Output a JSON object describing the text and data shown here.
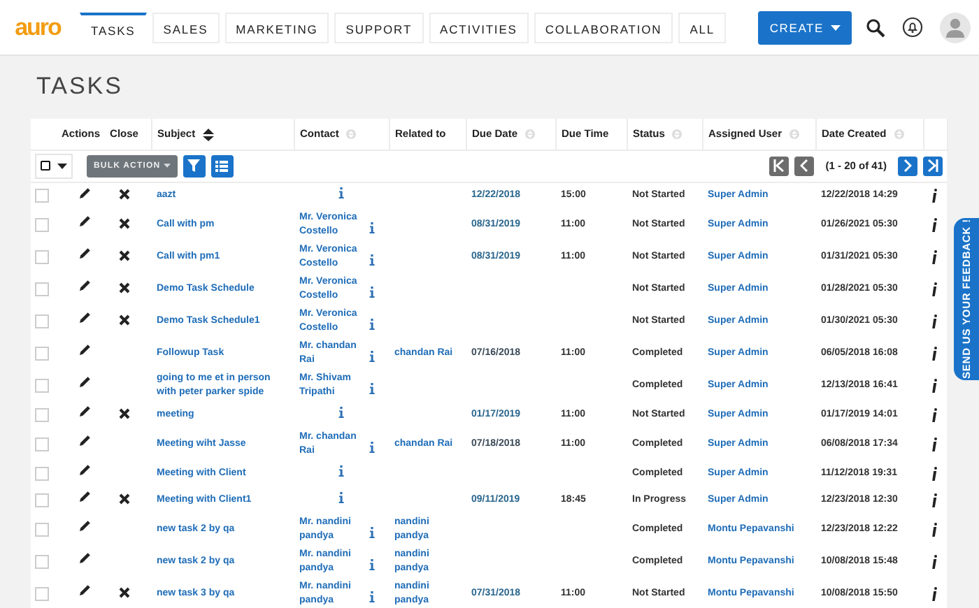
{
  "nav": {
    "logo": "auro",
    "tabs": [
      {
        "label": "TASKS",
        "selected": true
      },
      {
        "label": "SALES",
        "selected": false
      },
      {
        "label": "MARKETING",
        "selected": false
      },
      {
        "label": "SUPPORT",
        "selected": false
      },
      {
        "label": "ACTIVITIES",
        "selected": false
      },
      {
        "label": "COLLABORATION",
        "selected": false
      },
      {
        "label": "ALL",
        "selected": false
      }
    ],
    "create_button": "CREATE"
  },
  "page_title": "TASKS",
  "table": {
    "columns": [
      {
        "label": "Actions",
        "sortable": false
      },
      {
        "label": "Close",
        "sortable": false
      },
      {
        "label": "Subject",
        "sortable": true,
        "sorted": true
      },
      {
        "label": "Contact",
        "sortable": true,
        "sorted": false
      },
      {
        "label": "Related to",
        "sortable": false
      },
      {
        "label": "Due Date",
        "sortable": true,
        "sorted": false
      },
      {
        "label": "Due Time",
        "sortable": false
      },
      {
        "label": "Status",
        "sortable": true,
        "sorted": false
      },
      {
        "label": "Assigned User",
        "sortable": true,
        "sorted": false
      },
      {
        "label": "Date Created",
        "sortable": true,
        "sorted": false
      }
    ],
    "bulk_action": "BULK ACTION",
    "pagination": "(1 - 20 of 41)",
    "rows": [
      {
        "checked": false,
        "closable": true,
        "subject": "aazt",
        "contact": "",
        "related": "",
        "due_date": "12/22/2018",
        "due_time": "15:00",
        "status": "Not Started",
        "assigned": "Super Admin",
        "created": "12/22/2018 14:29"
      },
      {
        "checked": false,
        "closable": true,
        "subject": "Call with pm",
        "contact": "Mr. Veronica Costello",
        "related": "",
        "due_date": "08/31/2019",
        "due_time": "11:00",
        "status": "Not Started",
        "assigned": "Super Admin",
        "created": "01/26/2021 05:30"
      },
      {
        "checked": false,
        "closable": true,
        "subject": "Call with pm1",
        "contact": "Mr. Veronica Costello",
        "related": "",
        "due_date": "08/31/2019",
        "due_time": "11:00",
        "status": "Not Started",
        "assigned": "Super Admin",
        "created": "01/31/2021 05:30"
      },
      {
        "checked": false,
        "closable": true,
        "subject": "Demo Task Schedule",
        "contact": "Mr. Veronica Costello",
        "related": "",
        "due_date": "",
        "due_time": "",
        "status": "Not Started",
        "assigned": "Super Admin",
        "created": "01/28/2021 05:30"
      },
      {
        "checked": false,
        "closable": true,
        "subject": "Demo Task Schedule1",
        "contact": "Mr. Veronica Costello",
        "related": "",
        "due_date": "",
        "due_time": "",
        "status": "Not Started",
        "assigned": "Super Admin",
        "created": "01/30/2021 05:30"
      },
      {
        "checked": false,
        "closable": false,
        "subject": "Followup Task",
        "contact": "Mr. chandan Rai",
        "related": "chandan Rai",
        "due_date": "07/16/2018",
        "due_time": "11:00",
        "status": "Completed",
        "assigned": "Super Admin",
        "created": "06/05/2018 16:08"
      },
      {
        "checked": false,
        "closable": false,
        "subject": "going to me et in person with peter parker spide",
        "contact": "Mr. Shivam Tripathi",
        "related": "",
        "due_date": "",
        "due_time": "",
        "status": "Completed",
        "assigned": "Super Admin",
        "created": "12/13/2018 16:41"
      },
      {
        "checked": false,
        "closable": true,
        "subject": "meeting",
        "contact": "",
        "related": "",
        "due_date": "01/17/2019",
        "due_time": "11:00",
        "status": "Not Started",
        "assigned": "Super Admin",
        "created": "01/17/2019 14:01"
      },
      {
        "checked": false,
        "closable": false,
        "subject": "Meeting wiht Jasse",
        "contact": "Mr. chandan Rai",
        "related": "chandan Rai",
        "due_date": "07/18/2018",
        "due_time": "11:00",
        "status": "Completed",
        "assigned": "Super Admin",
        "created": "06/08/2018 17:34"
      },
      {
        "checked": false,
        "closable": false,
        "subject": "Meeting with Client",
        "contact": "",
        "related": "",
        "due_date": "",
        "due_time": "",
        "status": "Completed",
        "assigned": "Super Admin",
        "created": "11/12/2018 19:31"
      },
      {
        "checked": false,
        "closable": true,
        "subject": "Meeting with Client1",
        "contact": "",
        "related": "",
        "due_date": "09/11/2019",
        "due_time": "18:45",
        "status": "In Progress",
        "assigned": "Super Admin",
        "created": "12/23/2018 12:30"
      },
      {
        "checked": false,
        "closable": false,
        "subject": "new task 2 by qa",
        "contact": "Mr. nandini pandya",
        "related": "nandini pandya",
        "due_date": "",
        "due_time": "",
        "status": "Completed",
        "assigned": "Montu Pepavanshi",
        "created": "12/23/2018 12:22"
      },
      {
        "checked": false,
        "closable": false,
        "subject": "new task 2 by qa",
        "contact": "Mr. nandini pandya",
        "related": "nandini pandya",
        "due_date": "",
        "due_time": "",
        "status": "Completed",
        "assigned": "Montu Pepavanshi",
        "created": "10/08/2018 15:48"
      },
      {
        "checked": false,
        "closable": true,
        "subject": "new task 3 by qa",
        "contact": "Mr. nandini pandya",
        "related": "nandini pandya",
        "due_date": "07/31/2018",
        "due_time": "11:00",
        "status": "Not Started",
        "assigned": "Montu Pepavanshi",
        "created": "10/08/2018 15:50"
      }
    ]
  },
  "feedback_tab": "SEND US YOUR FEEDBACK !"
}
